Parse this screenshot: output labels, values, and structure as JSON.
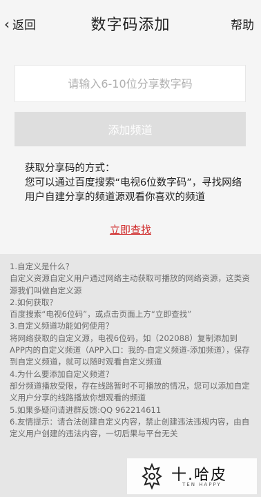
{
  "header": {
    "back_label": "返回",
    "title": "数字码添加",
    "help_label": "帮助"
  },
  "form": {
    "input_placeholder": "请输入6-10位分享数字码",
    "input_value": "",
    "add_button_label": "添加频道"
  },
  "howto": {
    "heading": "获取分享码的方式：",
    "body": "您可以通过百度搜索“电视6位数字码”，寻找网络用户自建分享的频道源观看你喜欢的频道",
    "lookup_link": "立即查找"
  },
  "faq": {
    "q1": "1.自定义是什么？",
    "a1": "自定义资源自定义用户通过网络主动获取可播放的网络资源，这类资源我们叫做自定义源",
    "q2": "2.如何获取？",
    "a2": "百度搜索“电视6位码”，或点击页面上方“立即查找”",
    "q3": "3.自定义频道功能如何使用？",
    "a3": "将网络获取的自定义源，电视6位码，如（202088）复制添加到APP内的自定义频道（APP入口：我的-自定义频道-添加频道），保存到自定义频道，就可以随时观看自定义频道",
    "q4": "4.为什么要添加自定义频道？",
    "a4": "部分频道播放受限，存在线路暂时不可播放的情况，您可以添加自定义用户分享的线路播放你想观看的频道",
    "q5": "5.如果多疑问请进群反馈:QQ 962214611",
    "q6": "6.友情提示：请合法创建自定义内容，禁止创建违法违规内容，由自定义用户创建的违法内容，一切后果与平台无关"
  },
  "watermark": {
    "brand": "十.哈皮",
    "sub": "TEN HAPPY"
  }
}
